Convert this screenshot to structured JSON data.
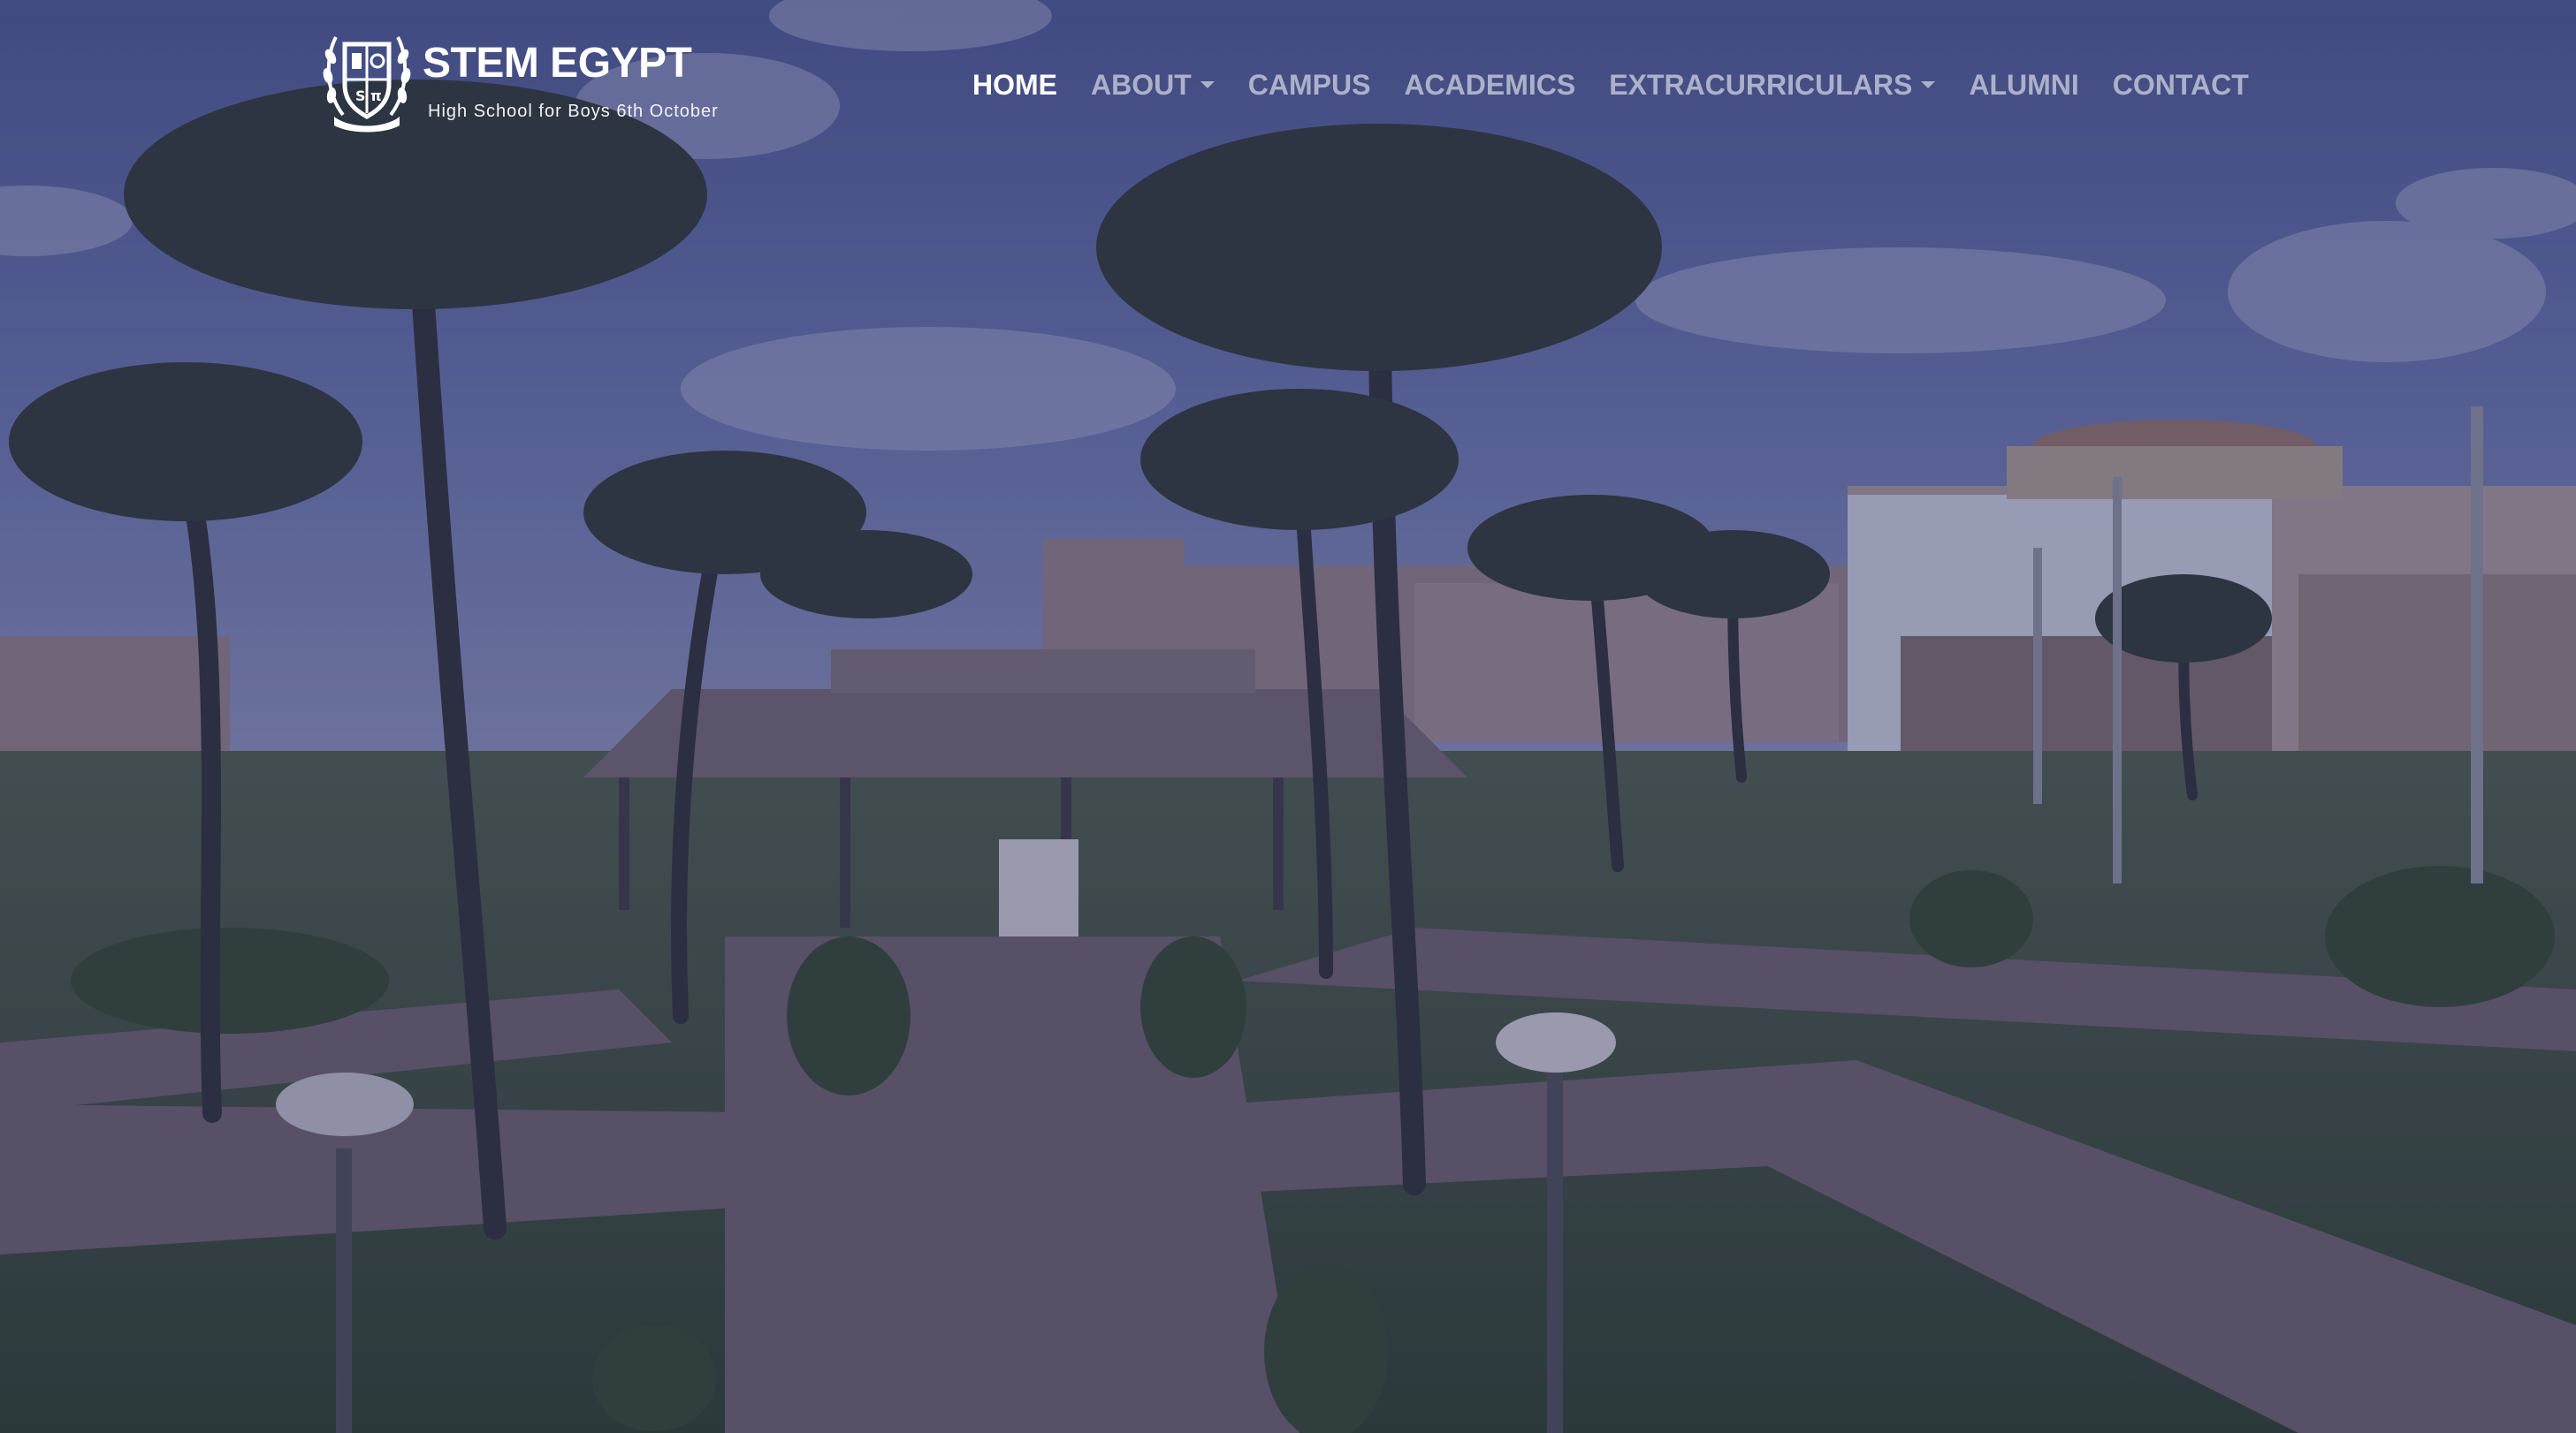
{
  "brand": {
    "name": "STEM EGYPT",
    "tagline": "High School for Boys 6th October"
  },
  "nav": {
    "items": [
      {
        "label": "HOME",
        "active": true,
        "has_dropdown": false
      },
      {
        "label": "ABOUT",
        "active": false,
        "has_dropdown": true
      },
      {
        "label": "CAMPUS",
        "active": false,
        "has_dropdown": false
      },
      {
        "label": "ACADEMICS",
        "active": false,
        "has_dropdown": false
      },
      {
        "label": "EXTRACURRICULARS",
        "active": false,
        "has_dropdown": true
      },
      {
        "label": "ALUMNI",
        "active": false,
        "has_dropdown": false
      },
      {
        "label": "CONTACT",
        "active": false,
        "has_dropdown": false
      }
    ]
  },
  "hero": {
    "image": "campus-courtyard-palm-trees-photo"
  },
  "colors": {
    "overlay": "#262c5c",
    "nav_active": "#ffffff",
    "nav_inactive": "#c4c8d6",
    "sky": "#5866a0",
    "grass": "#3f5a3c",
    "path": "#6d5f6a",
    "building": "#b9a6a1"
  }
}
